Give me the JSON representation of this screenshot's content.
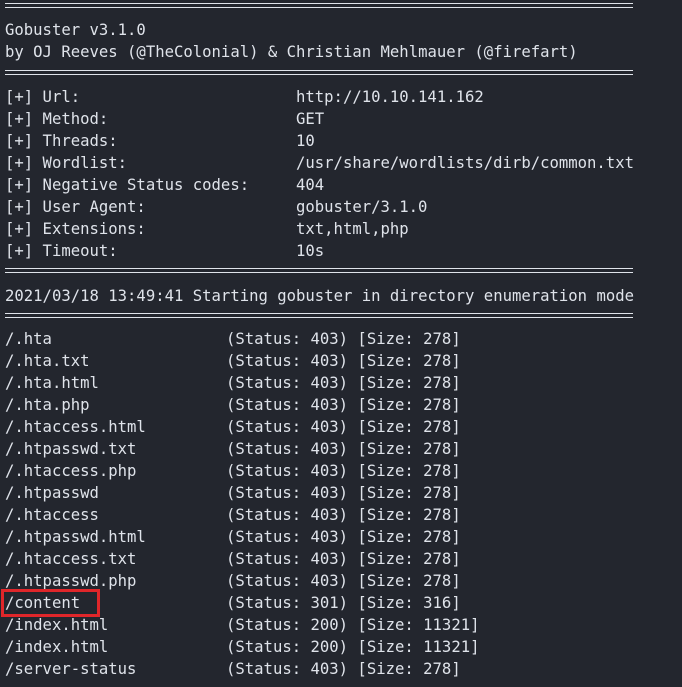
{
  "header": {
    "title": "Gobuster v3.1.0",
    "authors": "by OJ Reeves (@TheColonial) & Christian Mehlmauer (@firefart)"
  },
  "config": [
    {
      "key": "[+] Url:",
      "value": "http://10.10.141.162"
    },
    {
      "key": "[+] Method:",
      "value": "GET"
    },
    {
      "key": "[+] Threads:",
      "value": "10"
    },
    {
      "key": "[+] Wordlist:",
      "value": "/usr/share/wordlists/dirb/common.txt"
    },
    {
      "key": "[+] Negative Status codes:",
      "value": "404"
    },
    {
      "key": "[+] User Agent:",
      "value": "gobuster/3.1.0"
    },
    {
      "key": "[+] Extensions:",
      "value": "txt,html,php"
    },
    {
      "key": "[+] Timeout:",
      "value": "10s"
    }
  ],
  "start_message": "2021/03/18 13:49:41 Starting gobuster in directory enumeration mode",
  "results": [
    {
      "path": "/.hta",
      "info": "(Status: 403) [Size: 278]"
    },
    {
      "path": "/.hta.txt",
      "info": "(Status: 403) [Size: 278]"
    },
    {
      "path": "/.hta.html",
      "info": "(Status: 403) [Size: 278]"
    },
    {
      "path": "/.hta.php",
      "info": "(Status: 403) [Size: 278]"
    },
    {
      "path": "/.htaccess.html",
      "info": "(Status: 403) [Size: 278]"
    },
    {
      "path": "/.htpasswd.txt",
      "info": "(Status: 403) [Size: 278]"
    },
    {
      "path": "/.htaccess.php",
      "info": "(Status: 403) [Size: 278]"
    },
    {
      "path": "/.htpasswd",
      "info": "(Status: 403) [Size: 278]"
    },
    {
      "path": "/.htaccess",
      "info": "(Status: 403) [Size: 278]"
    },
    {
      "path": "/.htpasswd.html",
      "info": "(Status: 403) [Size: 278]"
    },
    {
      "path": "/.htaccess.txt",
      "info": "(Status: 403) [Size: 278]"
    },
    {
      "path": "/.htpasswd.php",
      "info": "(Status: 403) [Size: 278]"
    },
    {
      "path": "/content",
      "info": "(Status: 301) [Size: 316]"
    },
    {
      "path": "/index.html",
      "info": "(Status: 200) [Size: 11321]"
    },
    {
      "path": "/index.html",
      "info": "(Status: 200) [Size: 11321]"
    },
    {
      "path": "/server-status",
      "info": "(Status: 403) [Size: 278]"
    }
  ],
  "colors": {
    "background": "#23262e",
    "text": "#dfe3ea",
    "highlight": "#e0262a"
  }
}
